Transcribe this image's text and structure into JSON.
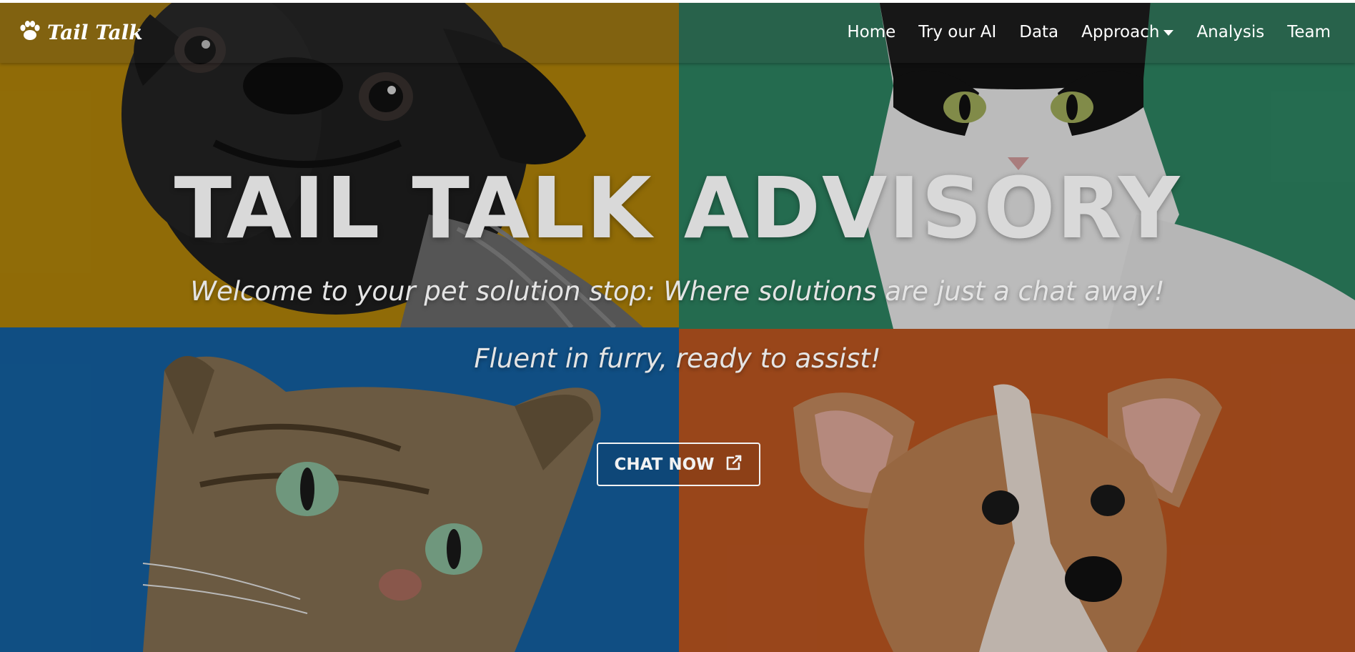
{
  "brand": {
    "icon": "paw-icon",
    "name": "Tail Talk"
  },
  "nav": {
    "items": [
      {
        "label": "Home"
      },
      {
        "label": "Try our AI"
      },
      {
        "label": "Data"
      },
      {
        "label": "Approach",
        "dropdown": true
      },
      {
        "label": "Analysis"
      },
      {
        "label": "Team"
      }
    ]
  },
  "hero": {
    "title": "TAIL TALK ADVISORY",
    "subtitle": "Welcome to your pet solution stop: Where solutions are just a chat away!",
    "tagline": "Fluent in furry, ready to assist!",
    "cta_label": "CHAT NOW",
    "cta_icon": "external-link-icon",
    "quadrant_colors": {
      "top_left": "#b98a0a",
      "top_right": "#2f8a66",
      "bottom_left": "#1565a8",
      "bottom_right": "#c45a22"
    },
    "photos": [
      "pug-photo",
      "tuxedo-cat-photo",
      "tabby-cat-photo",
      "corgi-puppy-photo"
    ]
  }
}
